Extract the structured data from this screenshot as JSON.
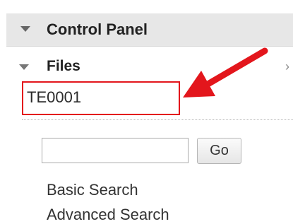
{
  "control_panel": {
    "title": "Control Panel",
    "expanded_icon": "triangle-down-icon"
  },
  "files": {
    "title": "Files",
    "expanded_icon": "triangle-down-icon",
    "chevron_icon": "chevron-right-icon",
    "chevron_glyph": "›",
    "items": [
      {
        "label": "TE0001",
        "highlight_color": "#e3161c"
      }
    ]
  },
  "search": {
    "input_value": "",
    "placeholder": "",
    "go_label": "Go"
  },
  "links": {
    "basic_search": "Basic Search",
    "advanced_search": "Advanced Search"
  },
  "annotation": {
    "icon": "red-arrow-icon",
    "color": "#e3161c"
  }
}
